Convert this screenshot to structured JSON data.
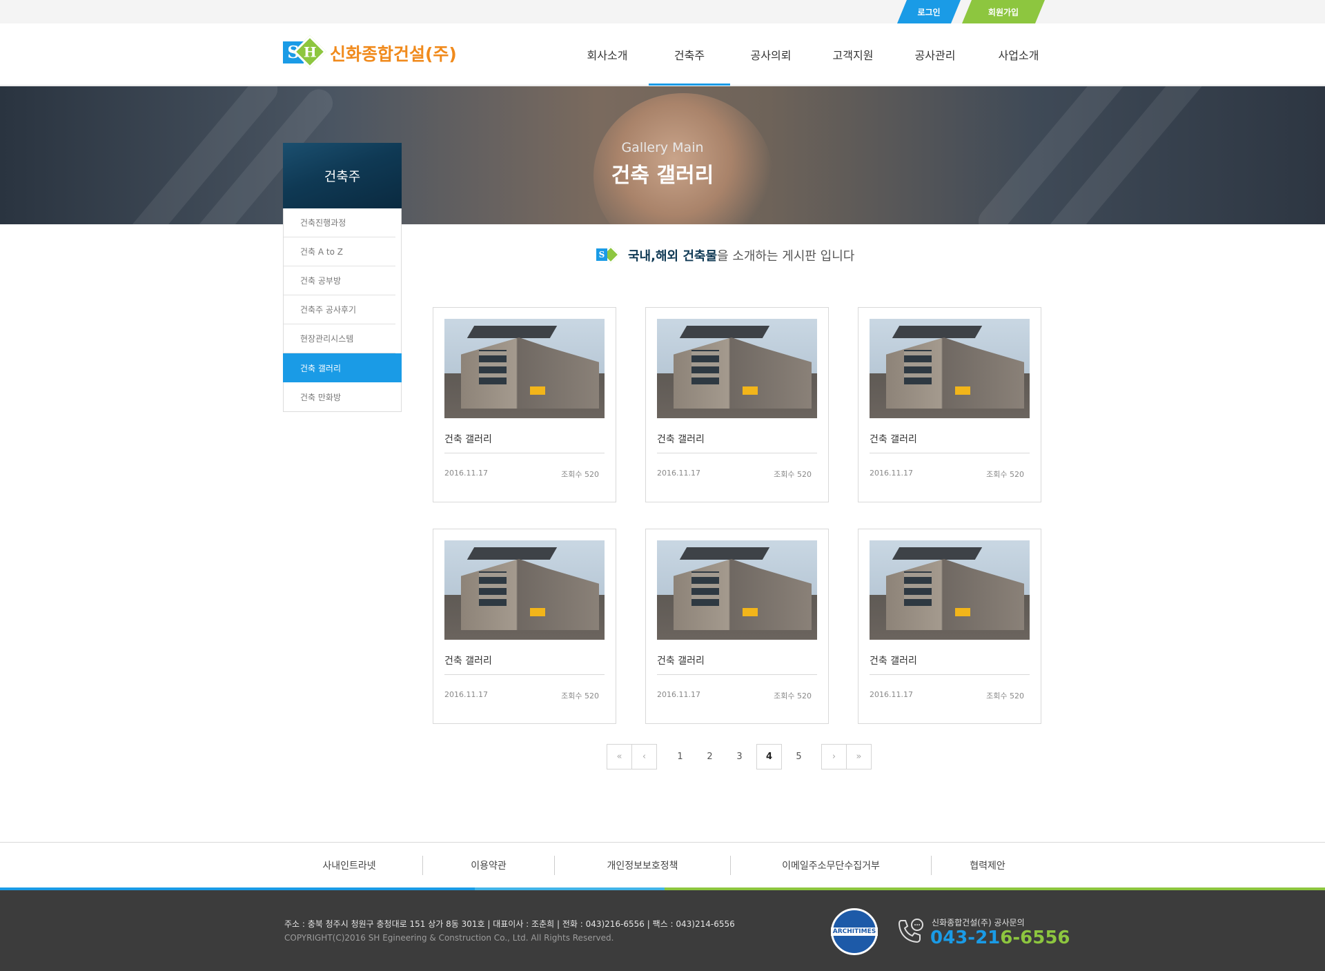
{
  "topbar": {
    "login": "로그인",
    "join": "회원가입"
  },
  "logo": {
    "text": "신화종합건설(주)",
    "mark_s": "S",
    "mark_h": "H"
  },
  "gnb": [
    "회사소개",
    "건축주",
    "공사의뢰",
    "고객지원",
    "공사관리",
    "사업소개"
  ],
  "hero": {
    "en": "Gallery Main",
    "ko": "건축 갤러리"
  },
  "sidebar": {
    "title": "건축주",
    "items": [
      "건축진행과정",
      "건축 A to Z",
      "건축 공부방",
      "건축주 공사후기",
      "현장관리시스템",
      "건축 갤러리",
      "건축 만화방"
    ],
    "active_index": 5
  },
  "intro": {
    "strong": "국내,해외 건축물",
    "rest": "을 소개하는 게시판 입니다"
  },
  "gallery": [
    {
      "title": "건축 갤러리",
      "date": "2016.11.17",
      "views": "조회수 520"
    },
    {
      "title": "건축 갤러리",
      "date": "2016.11.17",
      "views": "조회수 520"
    },
    {
      "title": "건축 갤러리",
      "date": "2016.11.17",
      "views": "조회수 520"
    },
    {
      "title": "건축 갤러리",
      "date": "2016.11.17",
      "views": "조회수 520"
    },
    {
      "title": "건축 갤러리",
      "date": "2016.11.17",
      "views": "조회수 520"
    },
    {
      "title": "건축 갤러리",
      "date": "2016.11.17",
      "views": "조회수 520"
    }
  ],
  "pagination": {
    "first": "«",
    "prev": "‹",
    "next": "›",
    "last": "»",
    "pages": [
      "1",
      "2",
      "3",
      "4",
      "5"
    ],
    "current": "4"
  },
  "footer_links": [
    "사내인트라넷",
    "이용약관",
    "개인정보보호정책",
    "이메일주소무단수집거부",
    "협력제안"
  ],
  "footer": {
    "address": "주소 : 충북 청주시 청원구 충청대로 151 상가 8동 301호  |  대표이사 : 조춘희  |  전화 : 043)216-6556  |  팩스 : 043)214-6556",
    "copyright": "COPYRIGHT(C)2016  SH Egineering & Construction  Co., Ltd. All Rights Reserved.",
    "badge": "ARCHITIMES",
    "cs_label": "신화종합건설(주) 공사문의",
    "cs_num_a": "043-21",
    "cs_num_b": "6-6556"
  },
  "colors": {
    "accent_blue": "#1a9be6",
    "accent_green": "#8dc63f",
    "logo_orange": "#f08a1c",
    "navy": "#0f3954"
  }
}
